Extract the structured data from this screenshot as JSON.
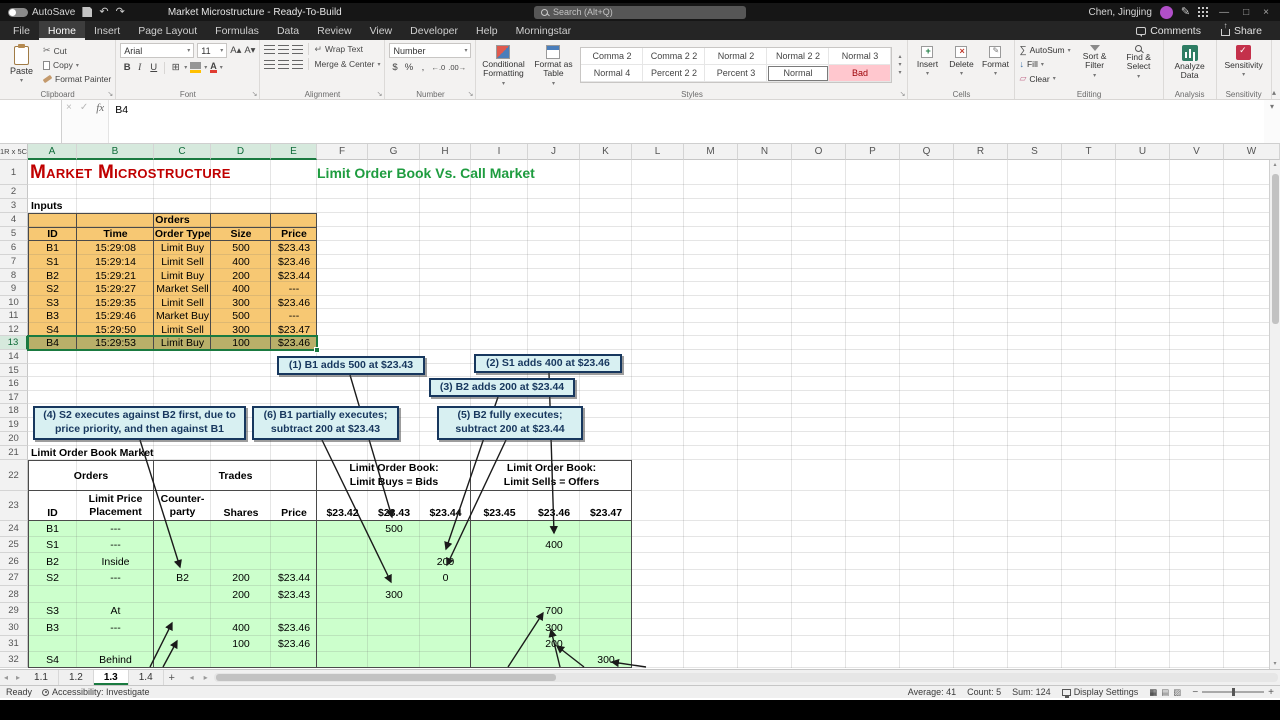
{
  "title_bar": {
    "autosave": "AutoSave",
    "document_title": "Market Microstructure - Ready-To-Build",
    "search_placeholder": "Search (Alt+Q)",
    "user_name": "Chen, Jingjing"
  },
  "ribbon_tabs": [
    {
      "label": "File",
      "active": false
    },
    {
      "label": "Home",
      "active": true
    },
    {
      "label": "Insert",
      "active": false
    },
    {
      "label": "Page Layout",
      "active": false
    },
    {
      "label": "Formulas",
      "active": false
    },
    {
      "label": "Data",
      "active": false
    },
    {
      "label": "Review",
      "active": false
    },
    {
      "label": "View",
      "active": false
    },
    {
      "label": "Developer",
      "active": false
    },
    {
      "label": "Help",
      "active": false
    },
    {
      "label": "Morningstar",
      "active": false
    }
  ],
  "ribbon_actions": {
    "comments": "Comments",
    "share": "Share"
  },
  "ribbon": {
    "clipboard": {
      "group": "Clipboard",
      "paste": "Paste",
      "cut": "Cut",
      "copy": "Copy",
      "format_painter": "Format Painter"
    },
    "font": {
      "group": "Font",
      "font_name": "Arial",
      "font_size": "11"
    },
    "alignment": {
      "group": "Alignment",
      "wrap_text": "Wrap Text",
      "merge_center": "Merge & Center"
    },
    "number": {
      "group": "Number",
      "format": "Number",
      "currency": "$",
      "percent": "%",
      "comma": ",",
      "inc_dec": "←.0",
      "dec_dec": ".00→"
    },
    "styles": {
      "group": "Styles",
      "conditional": "Conditional Formatting",
      "format_table": "Format as Table",
      "gallery": [
        [
          "Comma 2",
          "Comma 2 2",
          "Normal 2",
          "Normal 2 2",
          "Normal 3"
        ],
        [
          "Normal 4",
          "Percent 2 2",
          "Percent 3",
          "Normal",
          "Bad"
        ]
      ],
      "selected_style": "Normal",
      "bad_style": "Bad"
    },
    "cells": {
      "group": "Cells",
      "insert": "Insert",
      "delete": "Delete",
      "format": "Format"
    },
    "editing": {
      "group": "Editing",
      "autosum": "AutoSum",
      "fill": "Fill",
      "clear": "Clear",
      "sort": "Sort & Filter",
      "find": "Find & Select"
    },
    "analysis": {
      "group": "Analysis",
      "analyze": "Analyze Data"
    },
    "sensitivity": {
      "group": "Sensitivity",
      "label": "Sensitivity"
    }
  },
  "formula_bar": {
    "name_box": "",
    "fx": "fx",
    "content": "B4"
  },
  "grid": {
    "selection_indicator": "1R x 5C",
    "columns": [
      "A",
      "B",
      "C",
      "D",
      "E",
      "F",
      "G",
      "H",
      "I",
      "J",
      "K",
      "L",
      "M",
      "N",
      "O",
      "P",
      "Q",
      "R",
      "S",
      "T",
      "U",
      "V",
      "W"
    ],
    "row_count": 32,
    "selected_cols": [
      "A",
      "B",
      "C",
      "D",
      "E"
    ],
    "selected_row": 13
  },
  "cells": [
    {
      "r": 1,
      "c": "A",
      "t": "Market Microstructure",
      "cls": "t1",
      "span": 5
    },
    {
      "r": 1,
      "c": "F",
      "t": "Limit Order Book Vs. Call Market",
      "cls": "t2",
      "span": 7
    },
    {
      "r": 3,
      "c": "A",
      "t": "Inputs",
      "cls": "b"
    },
    {
      "r": 4,
      "c": "A",
      "t": "Orders",
      "cls": "hdr",
      "span": 5
    },
    {
      "r": 5,
      "c": "A",
      "t": "ID",
      "cls": "hdr"
    },
    {
      "r": 5,
      "c": "B",
      "t": "Time",
      "cls": "hdr"
    },
    {
      "r": 5,
      "c": "C",
      "t": "Order Type",
      "cls": "hdr"
    },
    {
      "r": 5,
      "c": "D",
      "t": "Size",
      "cls": "hdr"
    },
    {
      "r": 5,
      "c": "E",
      "t": "Price",
      "cls": "hdr"
    },
    {
      "r": 6,
      "c": "A",
      "t": "B1",
      "cls": "c"
    },
    {
      "r": 6,
      "c": "B",
      "t": "15:29:08",
      "cls": "c"
    },
    {
      "r": 6,
      "c": "C",
      "t": "Limit Buy",
      "cls": "c"
    },
    {
      "r": 6,
      "c": "D",
      "t": "500",
      "cls": "c"
    },
    {
      "r": 6,
      "c": "E",
      "t": "$23.43",
      "cls": "c"
    },
    {
      "r": 7,
      "c": "A",
      "t": "S1",
      "cls": "c"
    },
    {
      "r": 7,
      "c": "B",
      "t": "15:29:14",
      "cls": "c"
    },
    {
      "r": 7,
      "c": "C",
      "t": "Limit Sell",
      "cls": "c"
    },
    {
      "r": 7,
      "c": "D",
      "t": "400",
      "cls": "c"
    },
    {
      "r": 7,
      "c": "E",
      "t": "$23.46",
      "cls": "c"
    },
    {
      "r": 8,
      "c": "A",
      "t": "B2",
      "cls": "c"
    },
    {
      "r": 8,
      "c": "B",
      "t": "15:29:21",
      "cls": "c"
    },
    {
      "r": 8,
      "c": "C",
      "t": "Limit Buy",
      "cls": "c"
    },
    {
      "r": 8,
      "c": "D",
      "t": "200",
      "cls": "c"
    },
    {
      "r": 8,
      "c": "E",
      "t": "$23.44",
      "cls": "c"
    },
    {
      "r": 9,
      "c": "A",
      "t": "S2",
      "cls": "c"
    },
    {
      "r": 9,
      "c": "B",
      "t": "15:29:27",
      "cls": "c"
    },
    {
      "r": 9,
      "c": "C",
      "t": "Market Sell",
      "cls": "c"
    },
    {
      "r": 9,
      "c": "D",
      "t": "400",
      "cls": "c"
    },
    {
      "r": 9,
      "c": "E",
      "t": "---",
      "cls": "c"
    },
    {
      "r": 10,
      "c": "A",
      "t": "S3",
      "cls": "c"
    },
    {
      "r": 10,
      "c": "B",
      "t": "15:29:35",
      "cls": "c"
    },
    {
      "r": 10,
      "c": "C",
      "t": "Limit Sell",
      "cls": "c"
    },
    {
      "r": 10,
      "c": "D",
      "t": "300",
      "cls": "c"
    },
    {
      "r": 10,
      "c": "E",
      "t": "$23.46",
      "cls": "c"
    },
    {
      "r": 11,
      "c": "A",
      "t": "B3",
      "cls": "c"
    },
    {
      "r": 11,
      "c": "B",
      "t": "15:29:46",
      "cls": "c"
    },
    {
      "r": 11,
      "c": "C",
      "t": "Market Buy",
      "cls": "c"
    },
    {
      "r": 11,
      "c": "D",
      "t": "500",
      "cls": "c"
    },
    {
      "r": 11,
      "c": "E",
      "t": "---",
      "cls": "c"
    },
    {
      "r": 12,
      "c": "A",
      "t": "S4",
      "cls": "c"
    },
    {
      "r": 12,
      "c": "B",
      "t": "15:29:50",
      "cls": "c"
    },
    {
      "r": 12,
      "c": "C",
      "t": "Limit Sell",
      "cls": "c"
    },
    {
      "r": 12,
      "c": "D",
      "t": "300",
      "cls": "c"
    },
    {
      "r": 12,
      "c": "E",
      "t": "$23.47",
      "cls": "c"
    },
    {
      "r": 13,
      "c": "A",
      "t": "B4",
      "cls": "c"
    },
    {
      "r": 13,
      "c": "B",
      "t": "15:29:53",
      "cls": "c"
    },
    {
      "r": 13,
      "c": "C",
      "t": "Limit Buy",
      "cls": "c"
    },
    {
      "r": 13,
      "c": "D",
      "t": "100",
      "cls": "c"
    },
    {
      "r": 13,
      "c": "E",
      "t": "$23.46",
      "cls": "c"
    },
    {
      "r": 21,
      "c": "A",
      "t": "Limit Order Book Market",
      "cls": "b",
      "span": 3
    },
    {
      "r": 22,
      "c": "A",
      "t": "Orders",
      "cls": "hdr",
      "span": 2
    },
    {
      "r": 22,
      "c": "C",
      "t": "Trades",
      "cls": "hdr",
      "span": 3
    },
    {
      "r": 22,
      "c": "F",
      "t": "Limit Order Book:\nLimit Buys = Bids",
      "cls": "h2",
      "span": 3
    },
    {
      "r": 22,
      "c": "I",
      "t": "Limit Order Book:\nLimit Sells = Offers",
      "cls": "h2",
      "span": 3
    },
    {
      "r": 23,
      "c": "A",
      "t": "ID",
      "cls": "hb"
    },
    {
      "r": 23,
      "c": "B",
      "t": "Limit Price\nPlacement",
      "cls": "h2"
    },
    {
      "r": 23,
      "c": "C",
      "t": "Counter-\nparty",
      "cls": "h2"
    },
    {
      "r": 23,
      "c": "D",
      "t": "Shares",
      "cls": "hb"
    },
    {
      "r": 23,
      "c": "E",
      "t": "Price",
      "cls": "hb"
    },
    {
      "r": 23,
      "c": "F",
      "t": "$23.42",
      "cls": "hb"
    },
    {
      "r": 23,
      "c": "G",
      "t": "$23.43",
      "cls": "hb"
    },
    {
      "r": 23,
      "c": "H",
      "t": "$23.44",
      "cls": "hb"
    },
    {
      "r": 23,
      "c": "I",
      "t": "$23.45",
      "cls": "hb"
    },
    {
      "r": 23,
      "c": "J",
      "t": "$23.46",
      "cls": "hb"
    },
    {
      "r": 23,
      "c": "K",
      "t": "$23.47",
      "cls": "hb"
    },
    {
      "r": 24,
      "c": "A",
      "t": "B1",
      "cls": "c"
    },
    {
      "r": 24,
      "c": "B",
      "t": "---",
      "cls": "c"
    },
    {
      "r": 24,
      "c": "G",
      "t": "500",
      "cls": "c"
    },
    {
      "r": 25,
      "c": "A",
      "t": "S1",
      "cls": "c"
    },
    {
      "r": 25,
      "c": "B",
      "t": "---",
      "cls": "c"
    },
    {
      "r": 25,
      "c": "J",
      "t": "400",
      "cls": "c"
    },
    {
      "r": 26,
      "c": "A",
      "t": "B2",
      "cls": "c"
    },
    {
      "r": 26,
      "c": "B",
      "t": "Inside",
      "cls": "c"
    },
    {
      "r": 26,
      "c": "H",
      "t": "200",
      "cls": "c"
    },
    {
      "r": 27,
      "c": "A",
      "t": "S2",
      "cls": "c"
    },
    {
      "r": 27,
      "c": "B",
      "t": "---",
      "cls": "c"
    },
    {
      "r": 27,
      "c": "C",
      "t": "B2",
      "cls": "c"
    },
    {
      "r": 27,
      "c": "D",
      "t": "200",
      "cls": "c"
    },
    {
      "r": 27,
      "c": "E",
      "t": "$23.44",
      "cls": "c"
    },
    {
      "r": 27,
      "c": "H",
      "t": "0",
      "cls": "c"
    },
    {
      "r": 28,
      "c": "D",
      "t": "200",
      "cls": "c"
    },
    {
      "r": 28,
      "c": "E",
      "t": "$23.43",
      "cls": "c"
    },
    {
      "r": 28,
      "c": "G",
      "t": "300",
      "cls": "c"
    },
    {
      "r": 29,
      "c": "A",
      "t": "S3",
      "cls": "c"
    },
    {
      "r": 29,
      "c": "B",
      "t": "At",
      "cls": "c"
    },
    {
      "r": 29,
      "c": "J",
      "t": "700",
      "cls": "c"
    },
    {
      "r": 30,
      "c": "A",
      "t": "B3",
      "cls": "c"
    },
    {
      "r": 30,
      "c": "B",
      "t": "---",
      "cls": "c"
    },
    {
      "r": 30,
      "c": "D",
      "t": "400",
      "cls": "c"
    },
    {
      "r": 30,
      "c": "E",
      "t": "$23.46",
      "cls": "c"
    },
    {
      "r": 30,
      "c": "J",
      "t": "300",
      "cls": "c"
    },
    {
      "r": 31,
      "c": "D",
      "t": "100",
      "cls": "c"
    },
    {
      "r": 31,
      "c": "E",
      "t": "$23.46",
      "cls": "c"
    },
    {
      "r": 31,
      "c": "J",
      "t": "200",
      "cls": "c"
    },
    {
      "r": 32,
      "c": "A",
      "t": "S4",
      "cls": "c"
    },
    {
      "r": 32,
      "c": "B",
      "t": "Behind",
      "cls": "c"
    },
    {
      "r": 32,
      "c": "K",
      "t": "300",
      "cls": "c"
    }
  ],
  "callouts": [
    {
      "id": "c1",
      "t": "(1) B1 adds 500 at $23.43"
    },
    {
      "id": "c2",
      "t": "(2) S1 adds 400 at $23.46"
    },
    {
      "id": "c3",
      "t": "(3) B2 adds 200 at $23.44"
    },
    {
      "id": "c4",
      "t": "(4) S2 executes against B2 first, due to price priority, and then against B1"
    },
    {
      "id": "c6",
      "t": "(6) B1 partially executes; subtract 200 at $23.43"
    },
    {
      "id": "c5",
      "t": "(5) B2 fully executes; subtract 200 at $23.44"
    }
  ],
  "sheet_tabs": {
    "tabs": [
      "1.1",
      "1.2",
      "1.3",
      "1.4"
    ],
    "active": "1.3"
  },
  "status_bar": {
    "mode": "Ready",
    "accessibility": "Accessibility: Investigate",
    "average": "Average: 41",
    "count": "Count: 5",
    "sum": "Sum: 124",
    "display_settings": "Display Settings"
  },
  "icons": {
    "undo": "↶",
    "redo": "↷",
    "pen": "✎",
    "minimize": "—",
    "maximize": "□",
    "close": "×",
    "dropdown": "▾",
    "up": "▴",
    "down": "▾",
    "left": "◂",
    "right": "▸",
    "cut": "✂",
    "borders": "⊞",
    "bold": "B",
    "italic": "I",
    "underline": "U",
    "wrap_text": "↵",
    "autosum": "∑",
    "fill": "↓",
    "clear": "▱",
    "sort_filter": "funnel",
    "new_sheet": "+",
    "view_normal": "▦",
    "view_layout": "▤",
    "view_break": "▨",
    "zoom_out": "−",
    "zoom_in": "+",
    "collapse_ribbon": "▴"
  }
}
